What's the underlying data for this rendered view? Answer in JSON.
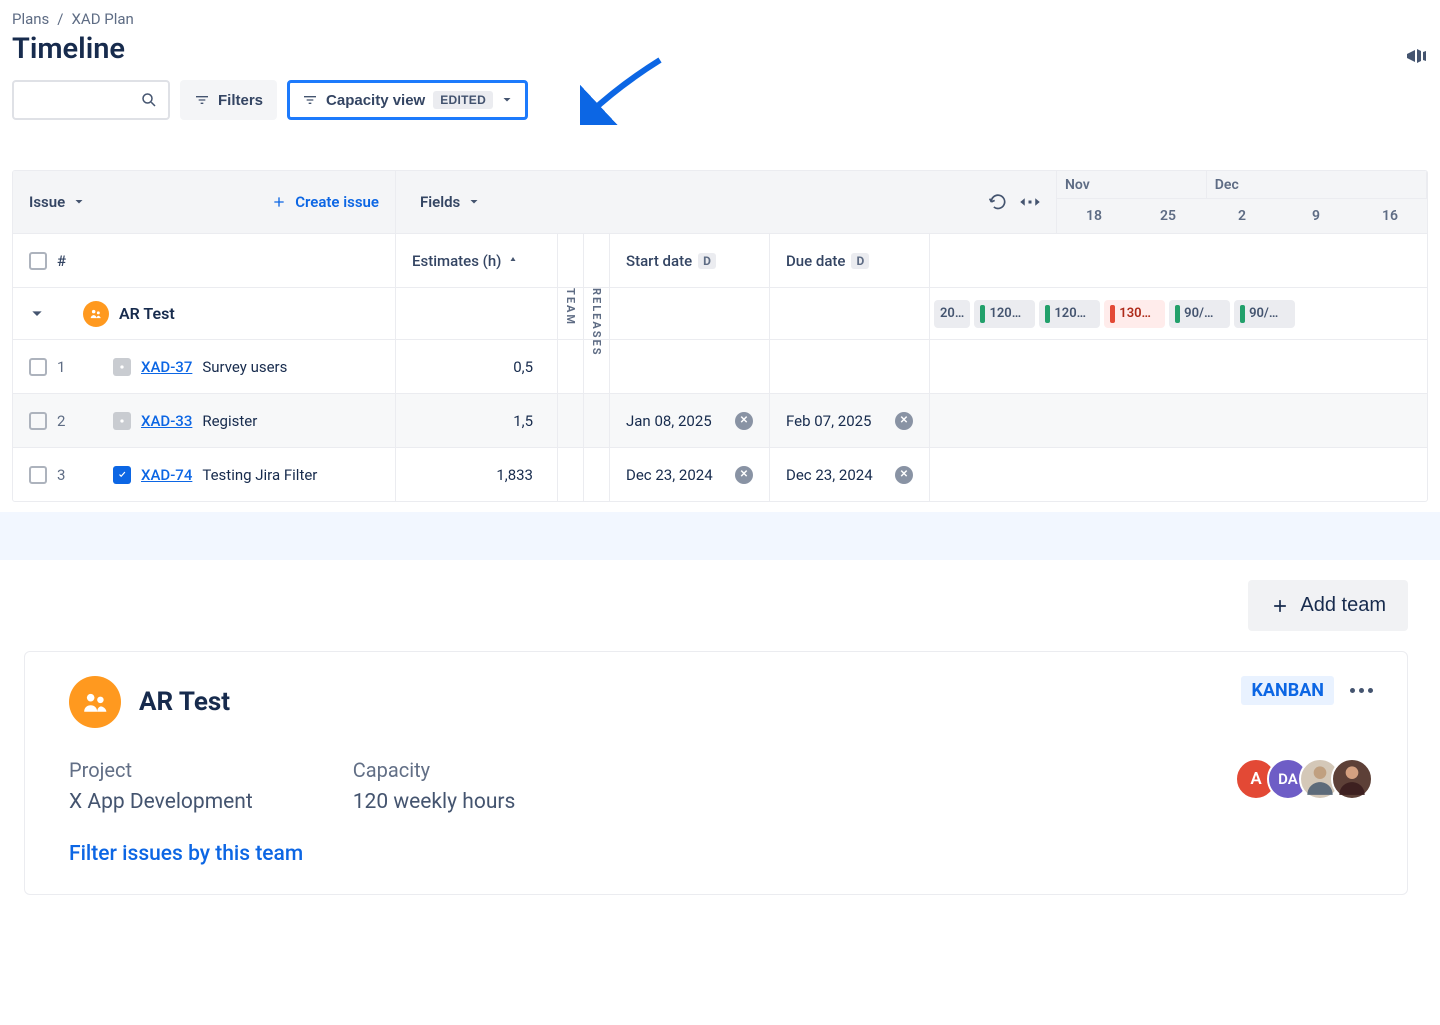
{
  "breadcrumb": {
    "parent": "Plans",
    "current": "XAD Plan"
  },
  "title": "Timeline",
  "toolbar": {
    "filters_label": "Filters",
    "view_label": "Capacity view",
    "view_badge": "EDITED"
  },
  "table": {
    "issue_header": "Issue",
    "create_label": "Create issue",
    "fields_label": "Fields",
    "hash": "#",
    "estimates_header": "Estimates (h)",
    "team_tab": "TEAM",
    "releases_tab": "RELEASES",
    "start_date_header": "Start date",
    "due_date_header": "Due date",
    "date_badge": "D",
    "timeline_months": [
      "Nov",
      "Dec"
    ],
    "timeline_days": [
      "18",
      "25",
      "2",
      "9",
      "16"
    ],
    "team_row_name": "AR Test",
    "capacity_pills": [
      {
        "label": "20…",
        "status": "ok",
        "partial": true
      },
      {
        "label": "120…",
        "status": "ok"
      },
      {
        "label": "120…",
        "status": "ok"
      },
      {
        "label": "130…",
        "status": "over"
      },
      {
        "label": "90/…",
        "status": "ok"
      },
      {
        "label": "90/…",
        "status": "ok"
      }
    ],
    "rows": [
      {
        "num": "1",
        "type": "story",
        "key": "XAD-37",
        "summary": "Survey users",
        "estimate": "0,5",
        "start": "",
        "due": ""
      },
      {
        "num": "2",
        "type": "story",
        "key": "XAD-33",
        "summary": "Register",
        "estimate": "1,5",
        "start": "Jan 08, 2025",
        "due": "Feb 07, 2025"
      },
      {
        "num": "3",
        "type": "task",
        "key": "XAD-74",
        "summary": "Testing Jira Filter",
        "estimate": "1,833",
        "start": "Dec 23, 2024",
        "due": "Dec 23, 2024"
      }
    ]
  },
  "add_team_label": "Add team",
  "team_card": {
    "name": "AR Test",
    "badge": "KANBAN",
    "project_label": "Project",
    "project_value": "X App Development",
    "capacity_label": "Capacity",
    "capacity_value": "120 weekly hours",
    "filter_link": "Filter issues by this team",
    "avatars": [
      "A",
      "DA",
      "",
      ""
    ]
  }
}
